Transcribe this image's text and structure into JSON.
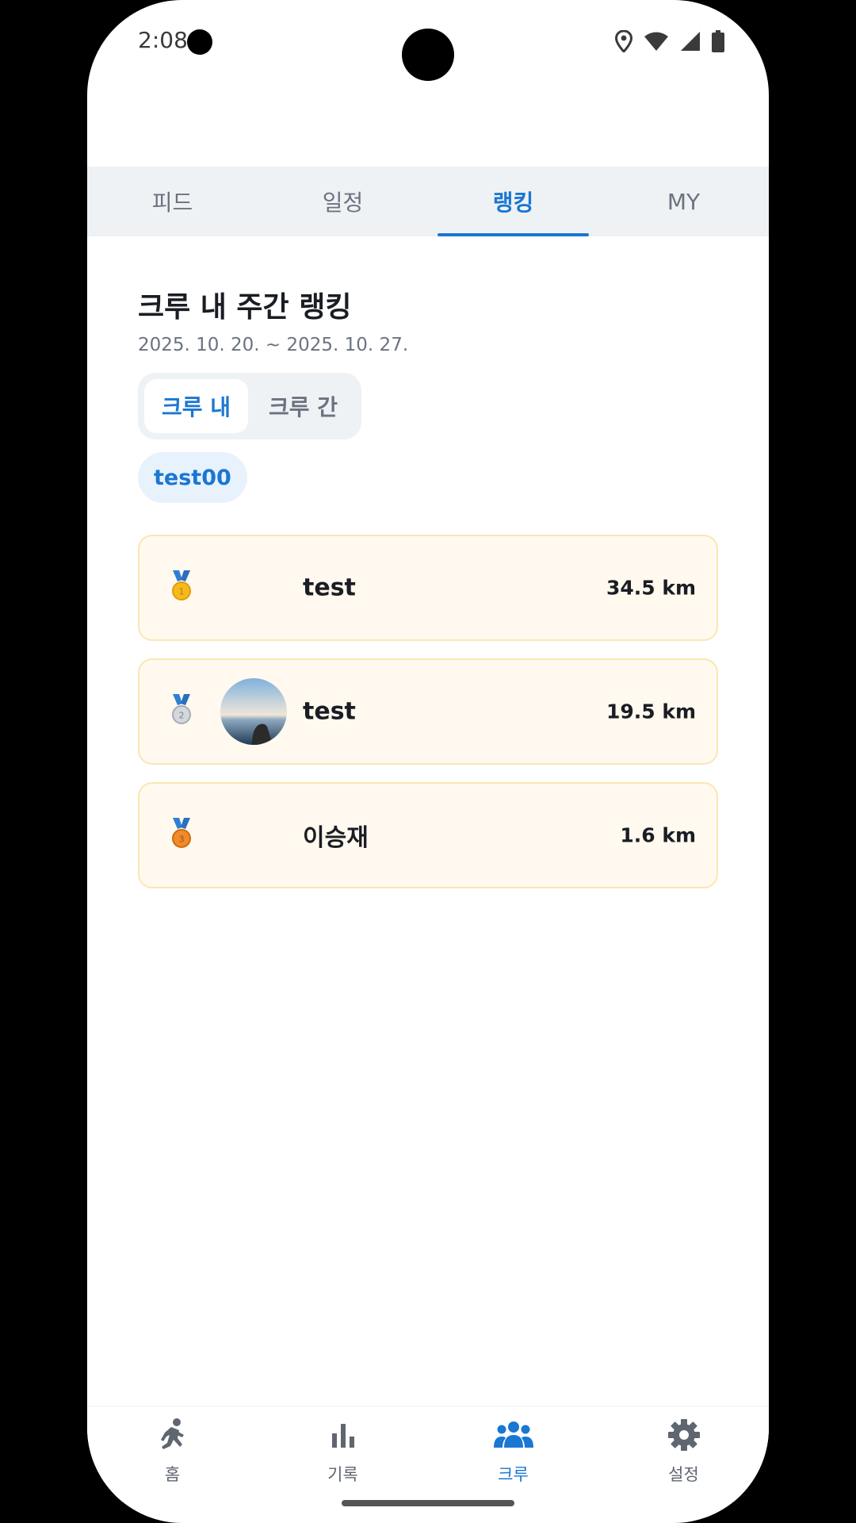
{
  "status": {
    "time": "2:08"
  },
  "tabs": [
    {
      "label": "피드",
      "active": false
    },
    {
      "label": "일정",
      "active": false
    },
    {
      "label": "랭킹",
      "active": true
    },
    {
      "label": "MY",
      "active": false
    }
  ],
  "ranking": {
    "title": "크루 내 주간 랭킹",
    "period": "2025. 10. 20. ~ 2025. 10. 27.",
    "segments": [
      {
        "label": "크루 내",
        "active": true
      },
      {
        "label": "크루 간",
        "active": false
      }
    ],
    "crew_chip": "test00",
    "entries": [
      {
        "rank": 1,
        "name": "test",
        "distance": "34.5 km",
        "medal": "gold-medal-icon",
        "has_avatar": false
      },
      {
        "rank": 2,
        "name": "test",
        "distance": "19.5 km",
        "medal": "silver-medal-icon",
        "has_avatar": true
      },
      {
        "rank": 3,
        "name": "이승재",
        "distance": "1.6 km",
        "medal": "bronze-medal-icon",
        "has_avatar": false
      }
    ]
  },
  "bottom_nav": [
    {
      "label": "홈",
      "icon": "run-icon",
      "active": false
    },
    {
      "label": "기록",
      "icon": "bar-chart-icon",
      "active": false
    },
    {
      "label": "크루",
      "icon": "group-icon",
      "active": true
    },
    {
      "label": "설정",
      "icon": "gear-icon",
      "active": false
    }
  ],
  "colors": {
    "accent": "#1a77d2",
    "row_bg": "#fff9ef",
    "row_border": "#fbe7b2",
    "tab_bg": "#eff2f4"
  }
}
